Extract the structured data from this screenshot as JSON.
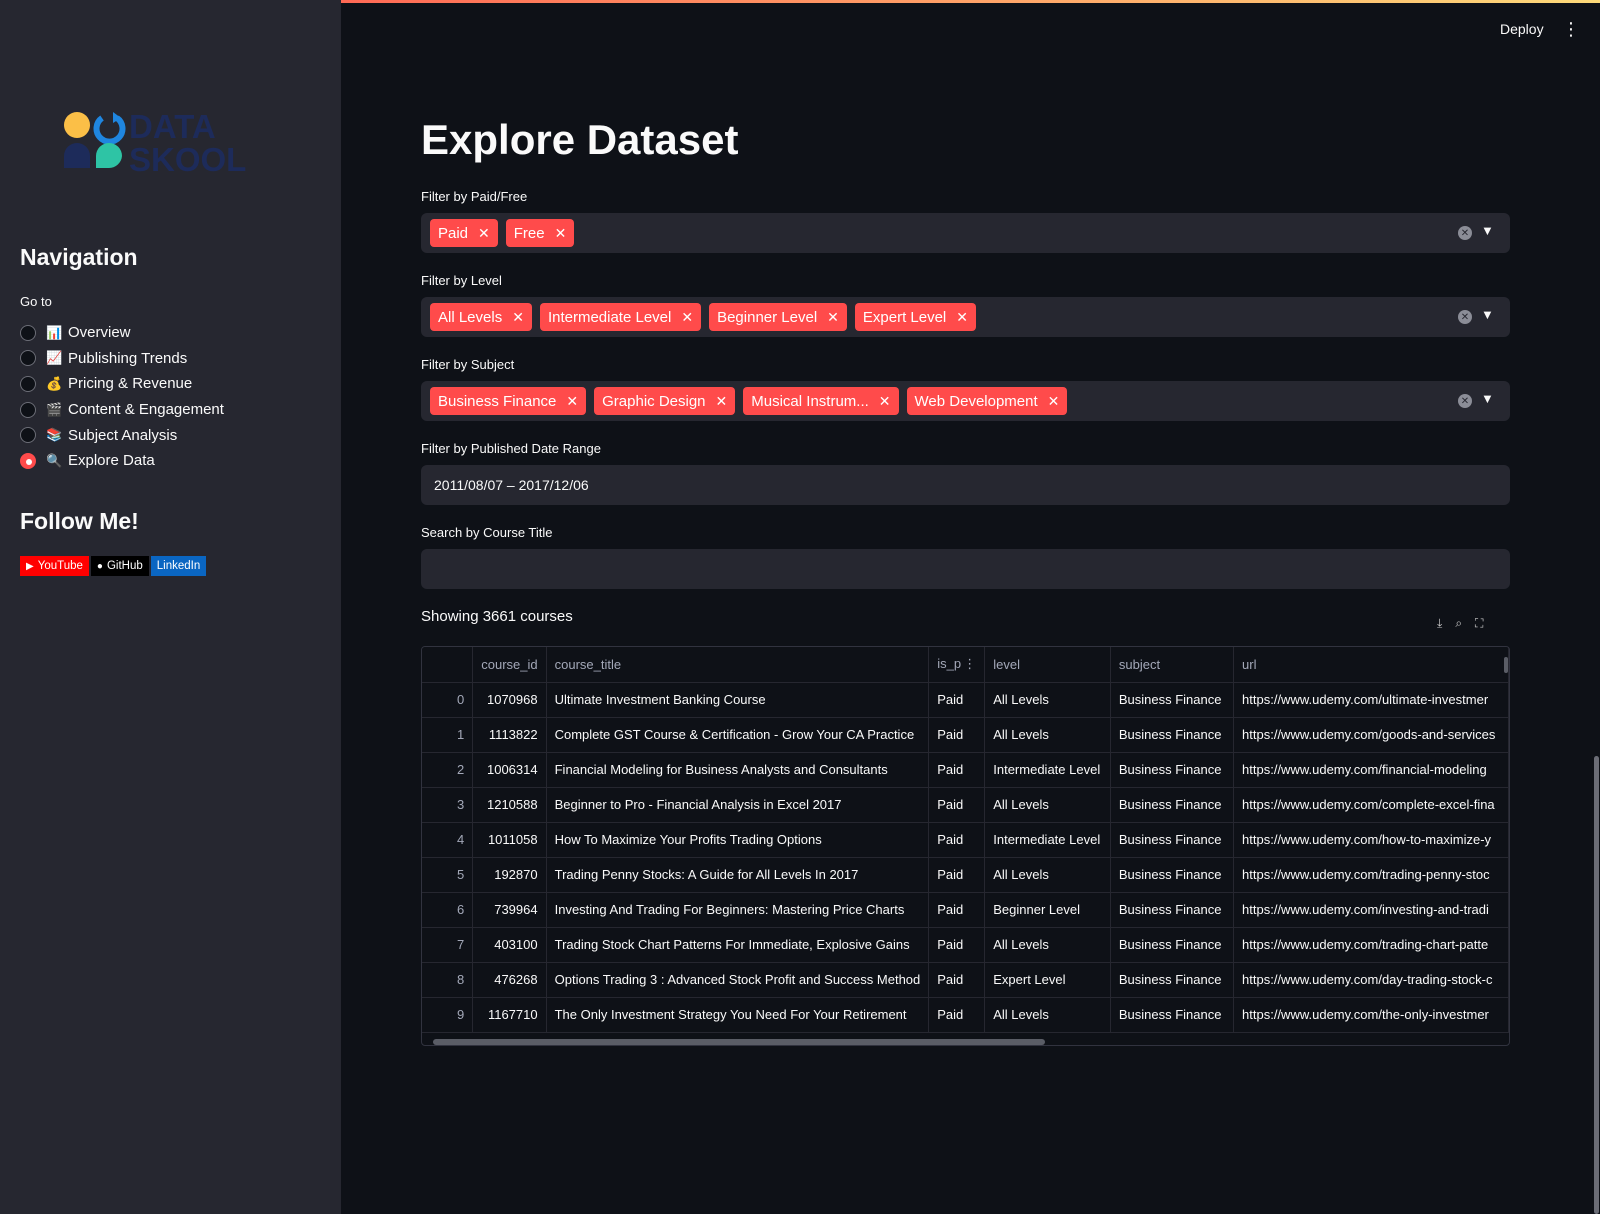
{
  "header": {
    "deploy_label": "Deploy",
    "menu_icon": "⋮"
  },
  "sidebar": {
    "logo_text_1": "DATA",
    "logo_text_2": "SKOOL",
    "nav_title": "Navigation",
    "goto_label": "Go to",
    "items": [
      {
        "emoji": "📊",
        "label": "Overview",
        "selected": false
      },
      {
        "emoji": "📈",
        "label": "Publishing Trends",
        "selected": false
      },
      {
        "emoji": "💰",
        "label": "Pricing & Revenue",
        "selected": false
      },
      {
        "emoji": "🎬",
        "label": "Content & Engagement",
        "selected": false
      },
      {
        "emoji": "📚",
        "label": "Subject Analysis",
        "selected": false
      },
      {
        "emoji": "🔍",
        "label": "Explore Data",
        "selected": true
      }
    ],
    "follow_title": "Follow Me!",
    "badges": {
      "youtube": "YouTube",
      "github": "GitHub",
      "linkedin": "LinkedIn"
    }
  },
  "main": {
    "title": "Explore Dataset",
    "filter_paid_label": "Filter by Paid/Free",
    "filter_paid_tags": [
      "Paid",
      "Free"
    ],
    "filter_level_label": "Filter by Level",
    "filter_level_tags": [
      "All Levels",
      "Intermediate Level",
      "Beginner Level",
      "Expert Level"
    ],
    "filter_subject_label": "Filter by Subject",
    "filter_subject_tags": [
      "Business Finance",
      "Graphic Design",
      "Musical Instrum...",
      "Web Development"
    ],
    "date_label": "Filter by Published Date Range",
    "date_value": "2011/08/07 – 2017/12/06",
    "search_label": "Search by Course Title",
    "search_value": "",
    "showing_text": "Showing 3661 courses"
  },
  "table": {
    "columns": [
      "",
      "course_id",
      "course_title",
      "is_p",
      "level",
      "subject",
      "url"
    ],
    "rows": [
      [
        "0",
        "1070968",
        "Ultimate Investment Banking Course",
        "Paid",
        "All Levels",
        "Business Finance",
        "https://www.udemy.com/ultimate-investmer"
      ],
      [
        "1",
        "1113822",
        "Complete GST Course & Certification - Grow Your CA Practice",
        "Paid",
        "All Levels",
        "Business Finance",
        "https://www.udemy.com/goods-and-services"
      ],
      [
        "2",
        "1006314",
        "Financial Modeling for Business Analysts and Consultants",
        "Paid",
        "Intermediate Level",
        "Business Finance",
        "https://www.udemy.com/financial-modeling"
      ],
      [
        "3",
        "1210588",
        "Beginner to Pro - Financial Analysis in Excel 2017",
        "Paid",
        "All Levels",
        "Business Finance",
        "https://www.udemy.com/complete-excel-fina"
      ],
      [
        "4",
        "1011058",
        "How To Maximize Your Profits Trading Options",
        "Paid",
        "Intermediate Level",
        "Business Finance",
        "https://www.udemy.com/how-to-maximize-y"
      ],
      [
        "5",
        "192870",
        "Trading Penny Stocks: A Guide for All Levels In 2017",
        "Paid",
        "All Levels",
        "Business Finance",
        "https://www.udemy.com/trading-penny-stoc"
      ],
      [
        "6",
        "739964",
        "Investing And Trading For Beginners: Mastering Price Charts",
        "Paid",
        "Beginner Level",
        "Business Finance",
        "https://www.udemy.com/investing-and-tradi"
      ],
      [
        "7",
        "403100",
        "Trading Stock Chart Patterns For Immediate, Explosive Gains",
        "Paid",
        "All Levels",
        "Business Finance",
        "https://www.udemy.com/trading-chart-patte"
      ],
      [
        "8",
        "476268",
        "Options Trading 3 : Advanced Stock Profit and Success Method",
        "Paid",
        "Expert Level",
        "Business Finance",
        "https://www.udemy.com/day-trading-stock-c"
      ],
      [
        "9",
        "1167710",
        "The Only Investment Strategy You Need For Your Retirement",
        "Paid",
        "All Levels",
        "Business Finance",
        "https://www.udemy.com/the-only-investmer"
      ]
    ]
  },
  "colors": {
    "accent": "#ff4b4b",
    "sidebar_bg": "#262730",
    "page_bg": "#0e1117"
  }
}
